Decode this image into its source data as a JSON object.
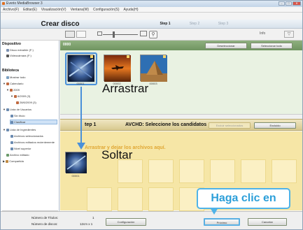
{
  "window": {
    "title": "Everio MediaBrowser 3",
    "controls": [
      "–",
      "□",
      "✕"
    ]
  },
  "menu": [
    "Archivo(F)",
    "Editar(E)",
    "Visualización(V)",
    "Ventana(W)",
    "Configuración(S)",
    "Ayuda(H)"
  ],
  "header": {
    "title": "Crear disco",
    "steps": [
      "Step 1",
      "Step 2",
      "Step 3"
    ]
  },
  "toolbar": {
    "info_label": "Info",
    "filter_icon": "filter-icon",
    "search_icon": "search-icon"
  },
  "sidebar": {
    "device_heading": "Dispositivo",
    "device_items": [
      "Disco extraíble (F:)",
      "Videocámara (F:)"
    ],
    "library_heading": "Biblioteca",
    "library_items": [
      "Mostrar todo",
      "Calendario",
      "2009",
      "6/2009 (3)",
      "28/6/2009 (3)",
      "Lista de Usuarios",
      "Sin título",
      "Clasificar",
      "Lista de Ingredientes",
      "Archivos seleccionados",
      "Archivos editados recientemente",
      "Nivel superior",
      "Archivo editado",
      "Compartida"
    ]
  },
  "top_area": {
    "label": "0000",
    "deselect_button": "Deseleccionar",
    "select_all_button": "Seleccionar todo",
    "thumbnails": [
      {
        "caption": "00001"
      },
      {
        "caption": "00002"
      },
      {
        "caption": "00003"
      }
    ]
  },
  "instructions": {
    "drag": "Arrastrar",
    "drop": "Soltar",
    "click": "Haga clic en"
  },
  "step1": {
    "label": "tep 1",
    "title": "AVCHD: Seleccione los candidatos",
    "exclude_button": "Excluir seleccionados",
    "excluded_button": "Excluido",
    "drop_hint": "Arrastrar y dejar los archivos aquí.",
    "dropped_caption": "00001"
  },
  "bottom": {
    "titles_label": "Número de Títulos:",
    "titles_value": "1",
    "discs_label": "Número de discos:",
    "discs_size": "12cm x 1",
    "config_button": "Configuración",
    "next_button": "Próximo",
    "cancel_button": "Cancelar"
  },
  "colors": {
    "accent": "#4fb3e8",
    "top_bar": "#7fa170",
    "drop_zone": "#f6e6a6"
  }
}
